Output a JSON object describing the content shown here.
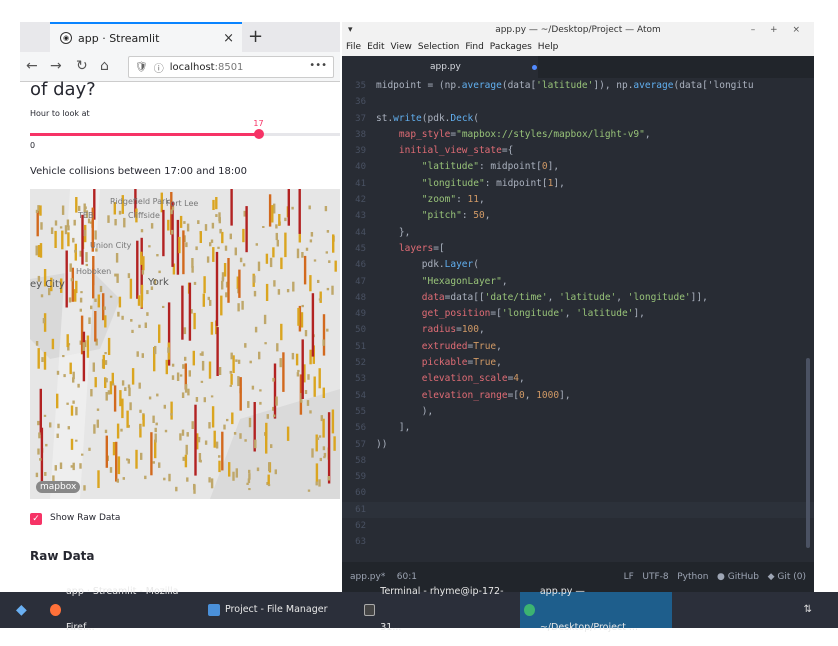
{
  "firefox": {
    "tab_title": "app · Streamlit",
    "tab_close": "×",
    "new_tab": "+",
    "url_host": "localhost",
    "url_port": ":8501",
    "url_menu": "•••",
    "back_icon": "arrow-left-icon",
    "forward_icon": "arrow-right-icon",
    "reload_icon": "reload-icon",
    "home_icon": "home-icon"
  },
  "streamlit": {
    "title_fragment": "of day?",
    "slider_label": "Hour to look at",
    "slider_value": "17",
    "slider_min": "0",
    "slider_fraction": 0.74,
    "subheader": "Vehicle collisions between 17:00 and 18:00",
    "map_labels": [
      "Ridgefield Park",
      "Fort Lee",
      "Cliffside",
      "Union City",
      "Hoboken",
      "ey City",
      "York",
      "TEB"
    ],
    "map_logo": "mapbox",
    "checkbox_label": "Show Raw Data",
    "raw_data_heading": "Raw Data",
    "accent_color": "#f63366"
  },
  "atom": {
    "window_title": "app.py — ~/Desktop/Project — Atom",
    "window_controls": "– + ×",
    "menu": [
      "File",
      "Edit",
      "View",
      "Selection",
      "Find",
      "Packages",
      "Help"
    ],
    "tab_label": "app.py",
    "line_numbers": [
      "35",
      "36",
      "37",
      "38",
      "39",
      "40",
      "41",
      "42",
      "43",
      "44",
      "45",
      "46",
      "47",
      "48",
      "49",
      "50",
      "51",
      "52",
      "53",
      "54",
      "55",
      "56",
      "57",
      "58",
      "59",
      "60",
      "61",
      "62",
      "63"
    ],
    "code_lines": [
      "midpoint = (np.average(data['latitude']), np.average(data['longitu",
      "",
      "st.write(pdk.Deck(",
      "    map_style=\"mapbox://styles/mapbox/light-v9\",",
      "    initial_view_state={",
      "        \"latitude\": midpoint[0],",
      "        \"longitude\": midpoint[1],",
      "        \"zoom\": 11,",
      "        \"pitch\": 50,",
      "    },",
      "    layers=[",
      "        pdk.Layer(",
      "        \"HexagonLayer\",",
      "        data=data[['date/time', 'latitude', 'longitude']],",
      "        get_position=['longitude', 'latitude'],",
      "        radius=100,",
      "        extruded=True,",
      "        pickable=True,",
      "        elevation_scale=4,",
      "        elevation_range=[0, 1000],",
      "        ),",
      "    ],",
      "))",
      "",
      "",
      "",
      "",
      "",
      ""
    ],
    "status_file": "app.py*",
    "status_pos": "60:1",
    "status_lf": "LF",
    "status_enc": "UTF-8",
    "status_lang": "Python",
    "status_github": "GitHub",
    "status_git": "Git (0)"
  },
  "taskbar": {
    "items": [
      "app · Streamlit - Mozilla Firef...",
      "Project - File Manager",
      "Terminal - rhyme@ip-172-31...",
      "app.py — ~/Desktop/Project ..."
    ],
    "tray": "⇅"
  }
}
